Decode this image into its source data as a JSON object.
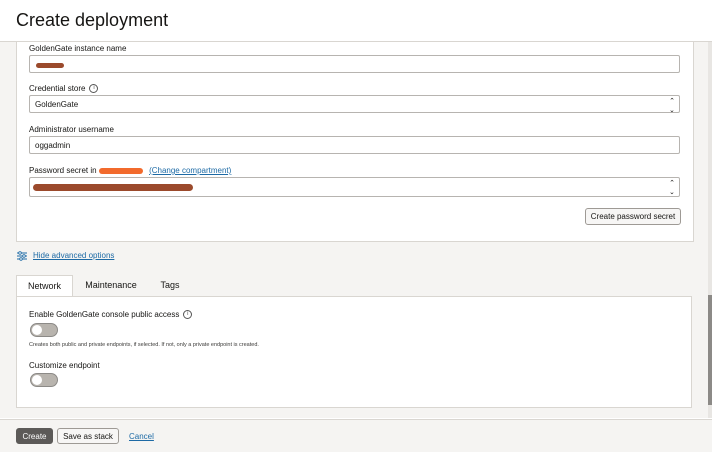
{
  "header": {
    "title": "Create deployment"
  },
  "form": {
    "instance_name_label": "GoldenGate instance name",
    "credential_store_label": "Credential store",
    "credential_store_value": "GoldenGate",
    "admin_username_label": "Administrator username",
    "admin_username_value": "oggadmin",
    "password_secret_label": "Password secret in",
    "change_compartment_link": "(Change compartment)",
    "create_password_secret_button": "Create password secret"
  },
  "advanced": {
    "link_label": "Hide advanced options"
  },
  "tabs": [
    {
      "label": "Network",
      "active": true
    },
    {
      "label": "Maintenance",
      "active": false
    },
    {
      "label": "Tags",
      "active": false
    }
  ],
  "network": {
    "public_access_label": "Enable GoldenGate console public access",
    "public_access_help": "Creates both public and private endpoints, if selected. If not, only a private endpoint is created.",
    "public_access_enabled": false,
    "customize_endpoint_label": "Customize endpoint",
    "customize_endpoint_enabled": false
  },
  "footer": {
    "create_button": "Create",
    "save_stack_button": "Save as stack",
    "cancel_link": "Cancel"
  },
  "colors": {
    "primary_button": "#5c5a58",
    "link": "#1d6aa5",
    "redaction_brown": "#9b4a2c",
    "redaction_orange": "#f26a2c"
  }
}
